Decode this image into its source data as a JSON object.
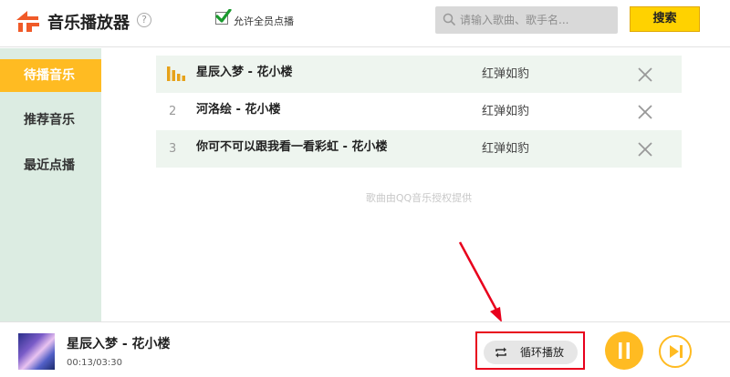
{
  "header": {
    "title": "音乐播放器",
    "help_icon": "help-circle-icon",
    "allow_all_label": "允许全员点播",
    "allow_all_checked": true,
    "search_placeholder": "请输入歌曲、歌手名...",
    "search_value": "",
    "search_button": "搜索"
  },
  "sidebar": {
    "items": [
      {
        "label": "待播音乐",
        "active": true
      },
      {
        "label": "推荐音乐",
        "active": false
      },
      {
        "label": "最近点播",
        "active": false
      }
    ]
  },
  "songs": [
    {
      "num": "",
      "playing": true,
      "title": "星辰入梦 - 花小楼",
      "artist": "红弹如豹"
    },
    {
      "num": "2",
      "playing": false,
      "title": "河洛绘 - 花小楼",
      "artist": "红弹如豹"
    },
    {
      "num": "3",
      "playing": false,
      "title": "你可不可以跟我看一看彩虹 - 花小楼",
      "artist": "红弹如豹"
    }
  ],
  "copyright": "歌曲由QQ音乐授权提供",
  "player": {
    "title": "星辰入梦 - 花小楼",
    "time": "00:13/03:30",
    "loop_label": "循环播放"
  },
  "colors": {
    "accent": "#ffbb22",
    "search_button": "#ffd200",
    "sidebar_bg": "#dcece2",
    "row_alt": "#eef5ef",
    "annotation": "#e8001c"
  }
}
